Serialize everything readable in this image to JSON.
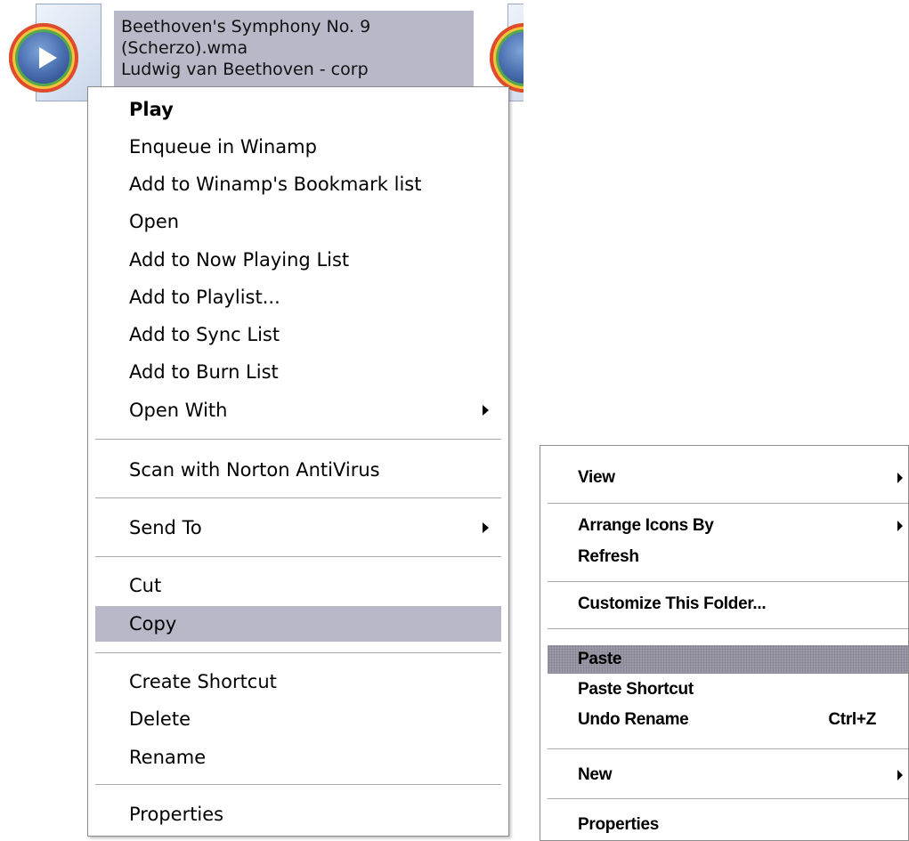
{
  "file": {
    "line1": "Beethoven's Symphony No. 9",
    "line2": "(Scherzo).wma",
    "line3": "Ludwig van Beethoven - corp"
  },
  "context_menu": {
    "items": [
      {
        "label": "Play"
      },
      {
        "label": "Enqueue in Winamp"
      },
      {
        "label": "Add to Winamp's Bookmark list"
      },
      {
        "label": "Open"
      },
      {
        "label": "Add to Now Playing List"
      },
      {
        "label": "Add to Playlist..."
      },
      {
        "label": "Add to Sync List"
      },
      {
        "label": "Add to Burn List"
      },
      {
        "label": "Open With"
      },
      {
        "label": "Scan with Norton AntiVirus"
      },
      {
        "label": "Send To"
      },
      {
        "label": "Cut"
      },
      {
        "label": "Copy"
      },
      {
        "label": "Create Shortcut"
      },
      {
        "label": "Delete"
      },
      {
        "label": "Rename"
      },
      {
        "label": "Properties"
      }
    ],
    "highlight_color": "#b9b8c9"
  },
  "folder_menu": {
    "items": [
      {
        "label": "View"
      },
      {
        "label": "Arrange Icons By"
      },
      {
        "label": "Refresh"
      },
      {
        "label": "Customize This Folder..."
      },
      {
        "label": "Paste"
      },
      {
        "label": "Paste Shortcut"
      },
      {
        "label": "Undo Rename",
        "shortcut": "Ctrl+Z"
      },
      {
        "label": "New"
      },
      {
        "label": "Properties"
      }
    ]
  }
}
